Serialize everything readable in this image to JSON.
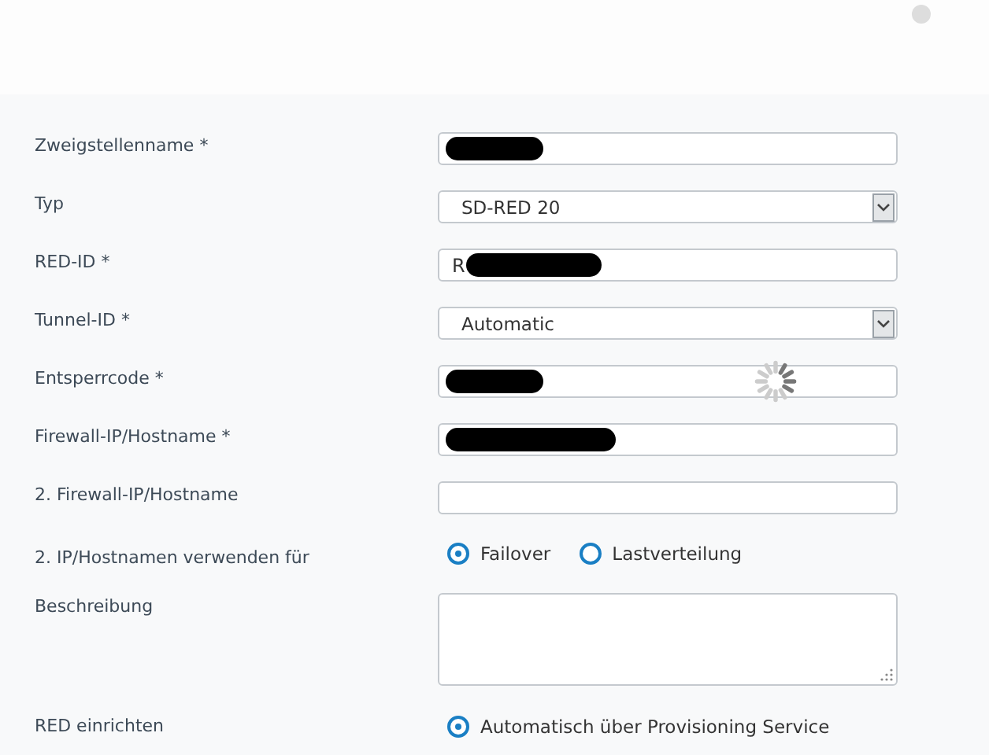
{
  "header": {
    "loading": true
  },
  "fields": [
    {
      "kind": "text",
      "label": "Zweigstellenname *",
      "redacted": true
    },
    {
      "kind": "select",
      "label": "Typ",
      "value": "SD-RED 20"
    },
    {
      "kind": "text",
      "label": "RED-ID *",
      "value": "R",
      "redacted": true
    },
    {
      "kind": "select",
      "label": "Tunnel-ID *",
      "value": "Automatic"
    },
    {
      "kind": "text",
      "label": "Entsperrcode *",
      "redacted": true,
      "loading": true
    },
    {
      "kind": "text",
      "label": "Firewall-IP/Hostname *",
      "redacted": true
    },
    {
      "kind": "text",
      "label": "2. Firewall-IP/Hostname"
    },
    {
      "kind": "radio",
      "label": "2. IP/Hostnamen verwenden für",
      "options": [
        {
          "label": "Failover",
          "selected": true
        },
        {
          "label": "Lastverteilung",
          "selected": false
        }
      ]
    },
    {
      "kind": "textarea",
      "label": "Beschreibung"
    },
    {
      "kind": "radio-stack",
      "label": "RED einrichten",
      "options": [
        {
          "label": "Automatisch über Provisioning Service",
          "selected": true
        }
      ]
    }
  ]
}
